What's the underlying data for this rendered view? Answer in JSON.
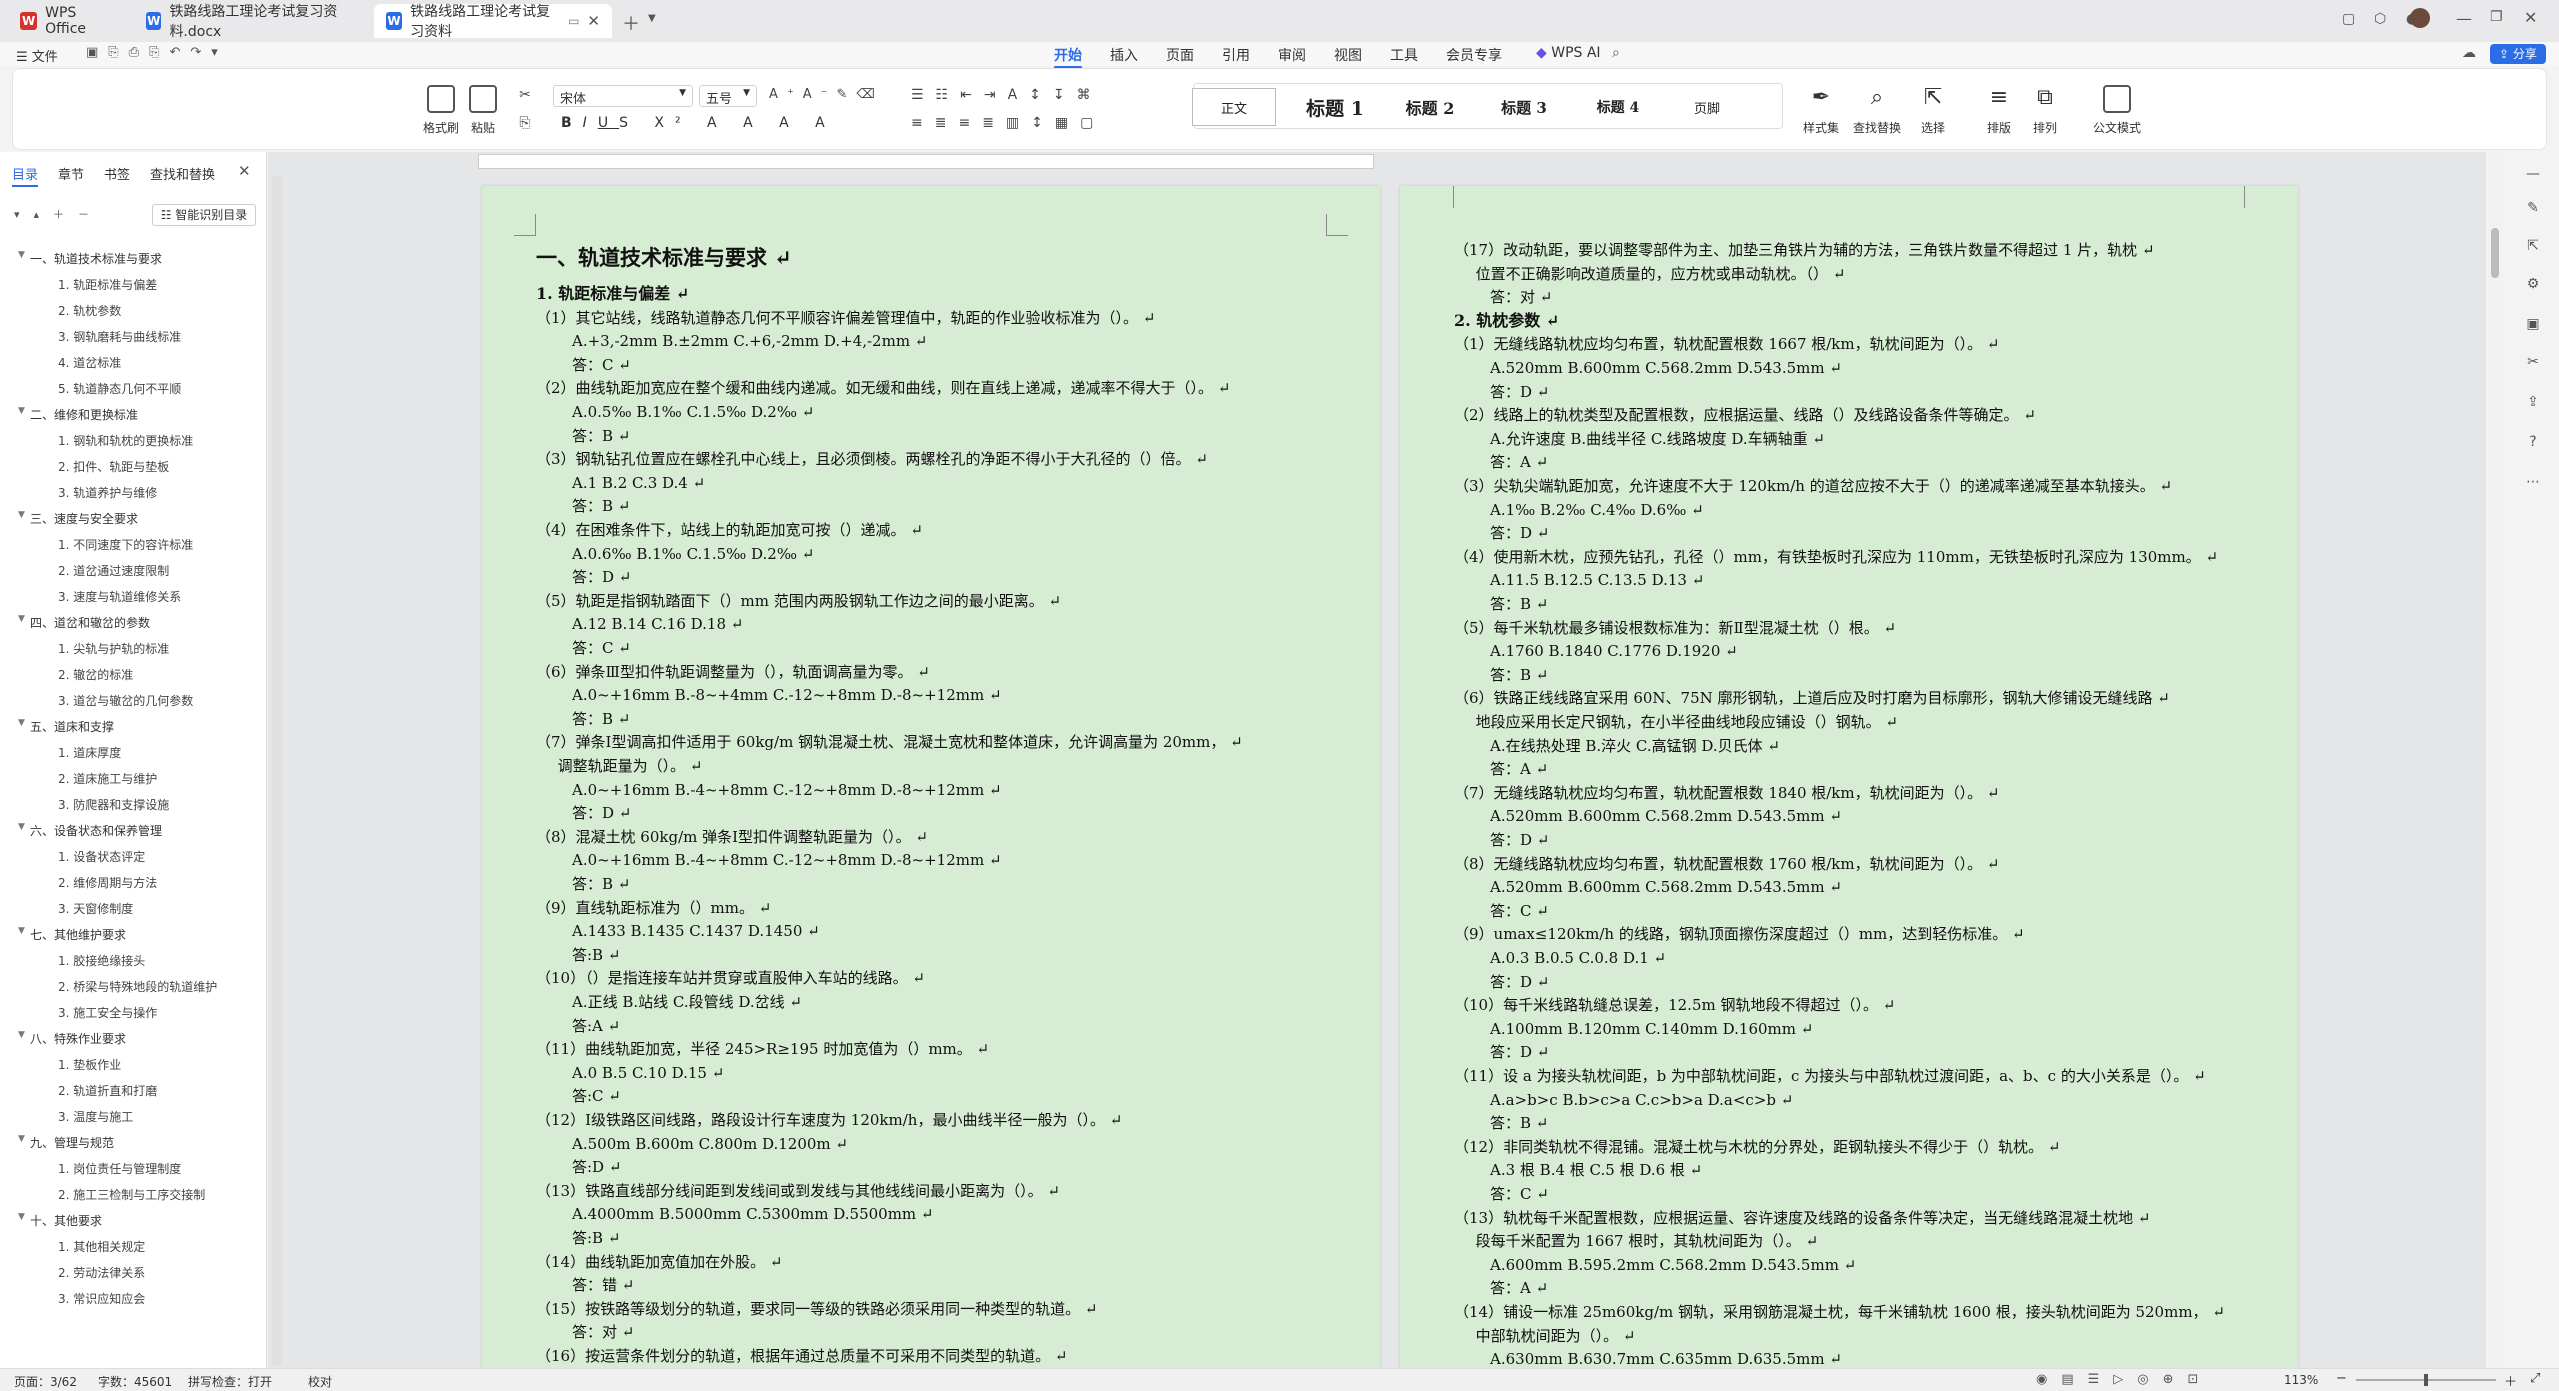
{
  "tabs": [
    {
      "label": "WPS Office"
    },
    {
      "label": "铁路线路工理论考试复习资料.docx"
    },
    {
      "label": "铁路线路工理论考试复习资料"
    }
  ],
  "menu": {
    "file": "文件"
  },
  "ribbon_tabs": [
    "开始",
    "插入",
    "页面",
    "引用",
    "审阅",
    "视图",
    "工具",
    "会员专享",
    "WPS AI"
  ],
  "share": "分享",
  "ribbon": {
    "format_painter": "格式刷",
    "paste": "粘贴",
    "font": "宋体",
    "size": "五号",
    "styles": [
      "正文",
      "标题 1",
      "标题 2",
      "标题 3",
      "标题 4",
      "页脚"
    ],
    "style_set": "样式集",
    "find_replace": "查找替换",
    "select": "选择",
    "arrange": "排版",
    "order": "排列",
    "official": "公文模式"
  },
  "panel": {
    "tabs": [
      "目录",
      "章节",
      "书签",
      "查找和替换"
    ],
    "smart": "智能识别目录"
  },
  "toc": [
    {
      "t": "一、轨道技术标准与要求",
      "l": 1
    },
    {
      "t": "1. 轨距标准与偏差",
      "l": 2
    },
    {
      "t": "2. 轨枕参数",
      "l": 2
    },
    {
      "t": "3. 钢轨磨耗与曲线标准",
      "l": 2
    },
    {
      "t": "4. 道岔标准",
      "l": 2
    },
    {
      "t": "5. 轨道静态几何不平顺",
      "l": 2
    },
    {
      "t": "二、维修和更换标准",
      "l": 1
    },
    {
      "t": "1. 钢轨和轨枕的更换标准",
      "l": 2
    },
    {
      "t": "2. 扣件、轨距与垫板",
      "l": 2
    },
    {
      "t": "3. 轨道养护与维修",
      "l": 2
    },
    {
      "t": "三、速度与安全要求",
      "l": 1
    },
    {
      "t": "1. 不同速度下的容许标准",
      "l": 2
    },
    {
      "t": "2. 道岔通过速度限制",
      "l": 2
    },
    {
      "t": "3. 速度与轨道维修关系",
      "l": 2
    },
    {
      "t": "四、道岔和辙岔的参数",
      "l": 1
    },
    {
      "t": "1. 尖轨与护轨的标准",
      "l": 2
    },
    {
      "t": "2. 辙岔的标准",
      "l": 2
    },
    {
      "t": "3. 道岔与辙岔的几何参数",
      "l": 2
    },
    {
      "t": "五、道床和支撑",
      "l": 1
    },
    {
      "t": "1. 道床厚度",
      "l": 2
    },
    {
      "t": "2. 道床施工与维护",
      "l": 2
    },
    {
      "t": "3. 防爬器和支撑设施",
      "l": 2
    },
    {
      "t": "六、设备状态和保养管理",
      "l": 1
    },
    {
      "t": "1. 设备状态评定",
      "l": 2
    },
    {
      "t": "2. 维修周期与方法",
      "l": 2
    },
    {
      "t": "3. 天窗修制度",
      "l": 2
    },
    {
      "t": "七、其他维护要求",
      "l": 1
    },
    {
      "t": "1. 胶接绝缘接头",
      "l": 2
    },
    {
      "t": "2. 桥梁与特殊地段的轨道维护",
      "l": 2
    },
    {
      "t": "3. 施工安全与操作",
      "l": 2
    },
    {
      "t": "八、特殊作业要求",
      "l": 1
    },
    {
      "t": "1. 垫板作业",
      "l": 2
    },
    {
      "t": "2. 轨道折直和打磨",
      "l": 2
    },
    {
      "t": "3. 温度与施工",
      "l": 2
    },
    {
      "t": "九、管理与规范",
      "l": 1
    },
    {
      "t": "1. 岗位责任与管理制度",
      "l": 2
    },
    {
      "t": "2. 施工三检制与工序交接制",
      "l": 2
    },
    {
      "t": "十、其他要求",
      "l": 1
    },
    {
      "t": "1. 其他相关规定",
      "l": 2
    },
    {
      "t": "2. 劳动法律关系",
      "l": 2
    },
    {
      "t": "3. 常识应知应会",
      "l": 2
    }
  ],
  "page1": [
    {
      "t": "一、轨道技术标准与要求",
      "c": "h1"
    },
    {
      "t": "1. 轨距标准与偏差",
      "c": "h2"
    },
    {
      "t": "（1）其它站线，线路轨道静态几何不平顺容许偏差管理值中，轨距的作业验收标准为（）。"
    },
    {
      "t": "A.+3,-2mm B.±2mm C.+6,-2mm D.+4,-2mm",
      "i": 1
    },
    {
      "t": "答：C",
      "i": 1
    },
    {
      "t": "（2）曲线轨距加宽应在整个缓和曲线内递减。如无缓和曲线，则在直线上递减，递减率不得大于（）。"
    },
    {
      "t": "A.0.5‰ B.1‰ C.1.5‰ D.2‰",
      "i": 1
    },
    {
      "t": "答：B",
      "i": 1
    },
    {
      "t": "（3）钢轨钻孔位置应在螺栓孔中心线上，且必须倒棱。两螺栓孔的净距不得小于大孔径的（）倍。"
    },
    {
      "t": "A.1 B.2 C.3 D.4",
      "i": 1
    },
    {
      "t": "答：B",
      "i": 1
    },
    {
      "t": "（4）在困难条件下，站线上的轨距加宽可按（）递减。"
    },
    {
      "t": "A.0.6‰ B.1‰ C.1.5‰ D.2‰",
      "i": 1
    },
    {
      "t": "答：D",
      "i": 1
    },
    {
      "t": "（5）轨距是指钢轨踏面下（）mm 范围内两股钢轨工作边之间的最小距离。"
    },
    {
      "t": "A.12 B.14 C.16 D.18",
      "i": 1
    },
    {
      "t": "答：C",
      "i": 1
    },
    {
      "t": "（6）弹条Ⅲ型扣件轨距调整量为（），轨面调高量为零。"
    },
    {
      "t": "A.0~+16mm B.-8~+4mm C.-12~+8mm D.-8~+12mm",
      "i": 1
    },
    {
      "t": "答：B",
      "i": 1
    },
    {
      "t": "（7）弹条Ⅰ型调高扣件适用于 60kg/m 钢轨混凝土枕、混凝土宽枕和整体道床，允许调高量为 20mm，"
    },
    {
      "t": "调整轨距量为（）。",
      "i": 0.6
    },
    {
      "t": "A.0~+16mm B.-4~+8mm C.-12~+8mm D.-8~+12mm",
      "i": 1
    },
    {
      "t": "答：D",
      "i": 1
    },
    {
      "t": "（8）混凝土枕 60kg/m 弹条Ⅰ型扣件调整轨距量为（）。"
    },
    {
      "t": "A.0~+16mm B.-4~+8mm C.-12~+8mm D.-8~+12mm",
      "i": 1
    },
    {
      "t": "答：B",
      "i": 1
    },
    {
      "t": "（9）直线轨距标准为（）mm。"
    },
    {
      "t": "A.1433 B.1435 C.1437 D.1450",
      "i": 1
    },
    {
      "t": "答:B",
      "i": 1
    },
    {
      "t": "（10）（）是指连接车站并贯穿或直股伸入车站的线路。"
    },
    {
      "t": "A.正线 B.站线 C.段管线 D.岔线",
      "i": 1
    },
    {
      "t": "答:A",
      "i": 1
    },
    {
      "t": "（11）曲线轨距加宽，半径 245>R≥195 时加宽值为（）mm。"
    },
    {
      "t": "A.0 B.5 C.10 D.15",
      "i": 1
    },
    {
      "t": "答:C",
      "i": 1
    },
    {
      "t": "（12）Ⅰ级铁路区间线路，路段设计行车速度为 120km/h，最小曲线半径一般为（）。"
    },
    {
      "t": "A.500m B.600m C.800m D.1200m",
      "i": 1
    },
    {
      "t": "答:D",
      "i": 1
    },
    {
      "t": "（13）铁路直线部分线间距到发线间或到发线与其他线线间最小距离为（）。"
    },
    {
      "t": "A.4000mm B.5000mm C.5300mm D.5500mm",
      "i": 1
    },
    {
      "t": "答:B",
      "i": 1
    },
    {
      "t": "（14）曲线轨距加宽值加在外股。"
    },
    {
      "t": "答：错",
      "i": 1
    },
    {
      "t": "（15）按铁路等级划分的轨道，要求同一等级的铁路必须采用同一种类型的轨道。"
    },
    {
      "t": "答：对",
      "i": 1
    },
    {
      "t": "（16）按运营条件划分的轨道，根据年通过总质量不可采用不同类型的轨道。"
    }
  ],
  "page2": [
    {
      "t": "（17）改动轨距，要以调整零部件为主、加垫三角铁片为辅的方法，三角铁片数量不得超过 1 片，轨枕"
    },
    {
      "t": "位置不正确影响改道质量的，应方枕或串动轨枕。（）",
      "i": 0.6
    },
    {
      "t": "答：对",
      "i": 1
    },
    {
      "t": "2. 轨枕参数",
      "c": "h2"
    },
    {
      "t": "（1）无缝线路轨枕应均匀布置，轨枕配置根数 1667 根/km，轨枕间距为（）。"
    },
    {
      "t": "A.520mm B.600mm C.568.2mm D.543.5mm",
      "i": 1
    },
    {
      "t": "答：D",
      "i": 1
    },
    {
      "t": "（2）线路上的轨枕类型及配置根数，应根据运量、线路（）及线路设备条件等确定。"
    },
    {
      "t": "A.允许速度 B.曲线半径 C.线路坡度 D.车辆轴重",
      "i": 1
    },
    {
      "t": "答：A",
      "i": 1
    },
    {
      "t": "（3）尖轨尖端轨距加宽，允许速度不大于 120km/h 的道岔应按不大于（）的递减率递减至基本轨接头。"
    },
    {
      "t": "A.1‰ B.2‰ C.4‰ D.6‰",
      "i": 1
    },
    {
      "t": "答：D",
      "i": 1
    },
    {
      "t": "（4）使用新木枕，应预先钻孔，孔径（）mm，有铁垫板时孔深应为 110mm，无铁垫板时孔深应为 130mm。"
    },
    {
      "t": "A.11.5 B.12.5 C.13.5 D.13",
      "i": 1
    },
    {
      "t": "答：B",
      "i": 1
    },
    {
      "t": "（5）每千米轨枕最多铺设根数标准为：新Ⅱ型混凝土枕（）根。"
    },
    {
      "t": "A.1760 B.1840 C.1776 D.1920",
      "i": 1
    },
    {
      "t": "答：B",
      "i": 1
    },
    {
      "t": "（6）铁路正线线路宜采用 60N、75N 廓形钢轨，上道后应及时打磨为目标廓形，钢轨大修铺设无缝线路"
    },
    {
      "t": "地段应采用长定尺钢轨，在小半径曲线地段应铺设（）钢轨。",
      "i": 0.6
    },
    {
      "t": "A.在线热处理 B.淬火 C.高锰钢 D.贝氏体",
      "i": 1
    },
    {
      "t": "答：A",
      "i": 1
    },
    {
      "t": "（7）无缝线路轨枕应均匀布置，轨枕配置根数 1840 根/km，轨枕间距为（）。"
    },
    {
      "t": "A.520mm B.600mm C.568.2mm D.543.5mm",
      "i": 1
    },
    {
      "t": "答：D",
      "i": 1
    },
    {
      "t": "（8）无缝线路轨枕应均匀布置，轨枕配置根数 1760 根/km，轨枕间距为（）。"
    },
    {
      "t": "A.520mm B.600mm C.568.2mm D.543.5mm",
      "i": 1
    },
    {
      "t": "答：C",
      "i": 1
    },
    {
      "t": "（9）umax≤120km/h 的线路，钢轨顶面擦伤深度超过（）mm，达到轻伤标准。"
    },
    {
      "t": "A.0.3 B.0.5 C.0.8 D.1",
      "i": 1
    },
    {
      "t": "答：D",
      "i": 1
    },
    {
      "t": "（10）每千米线路轨缝总误差，12.5m 钢轨地段不得超过（）。"
    },
    {
      "t": "A.100mm B.120mm C.140mm D.160mm",
      "i": 1
    },
    {
      "t": "答：D",
      "i": 1
    },
    {
      "t": "（11）设 a 为接头轨枕间距，b 为中部轨枕间距，c 为接头与中部轨枕过渡间距，a、b、c 的大小关系是（）。"
    },
    {
      "t": "A.a>b>c B.b>c>a C.c>b>a D.a<c>b",
      "i": 1
    },
    {
      "t": "答：B",
      "i": 1
    },
    {
      "t": "（12）非同类轨枕不得混铺。混凝土枕与木枕的分界处，距钢轨接头不得少于（）轨枕。"
    },
    {
      "t": "A.3 根 B.4 根 C.5 根 D.6 根",
      "i": 1
    },
    {
      "t": "答：C",
      "i": 1
    },
    {
      "t": "（13）轨枕每千米配置根数，应根据运量、容许速度及线路的设备条件等决定，当无缝线路混凝土枕地"
    },
    {
      "t": "段每千米配置为 1667 根时，其轨枕间距为（）。",
      "i": 0.6
    },
    {
      "t": "A.600mm B.595.2mm C.568.2mm D.543.5mm",
      "i": 1
    },
    {
      "t": "答：A",
      "i": 1
    },
    {
      "t": "（14）铺设一标准 25m60kg/m 钢轨，采用钢筋混凝土枕，每千米铺轨枕 1600 根，接头轨枕间距为 520mm，"
    },
    {
      "t": "中部轨枕间距为（）。",
      "i": 0.6
    },
    {
      "t": "A.630mm B.630.7mm C.635mm D.635.5mm",
      "i": 1
    }
  ],
  "status": {
    "page": "页面：3/62",
    "words": "字数：45601",
    "spell": "拼写检查：打开",
    "proof": "校对",
    "zoom": "113%"
  }
}
